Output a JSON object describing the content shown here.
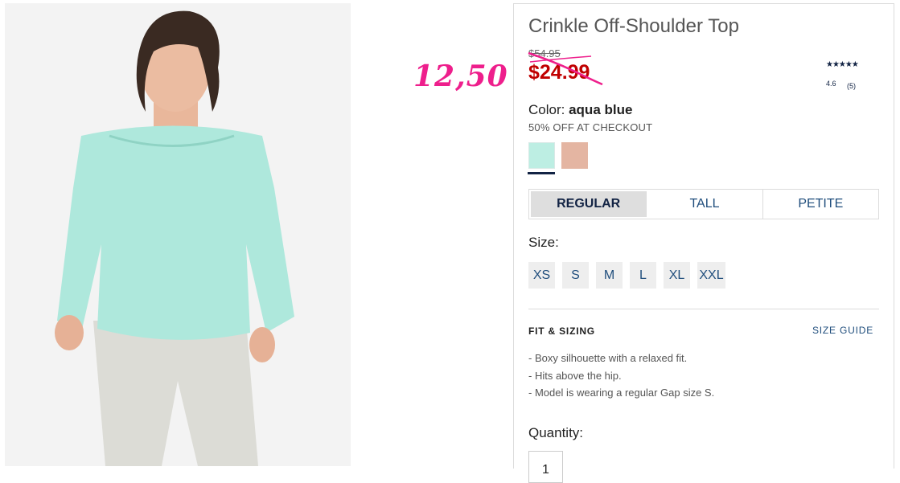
{
  "product": {
    "title": "Crinkle Off-Shoulder Top",
    "original_price": "$54.95",
    "sale_price": "$24.99",
    "annotation_price": "12,50",
    "rating": {
      "stars": "★★★★★",
      "value": "4.6",
      "count": "(5)"
    },
    "color_label": "Color:",
    "color_name": "aqua blue",
    "promo": "50% OFF AT CHECKOUT",
    "swatches": [
      {
        "name": "aqua blue",
        "color": "#bdeee3",
        "selected": true
      },
      {
        "name": "blush",
        "color": "#e4b5a2",
        "selected": false
      }
    ]
  },
  "fit_tabs": [
    {
      "label": "REGULAR",
      "active": true
    },
    {
      "label": "TALL",
      "active": false
    },
    {
      "label": "PETITE",
      "active": false
    }
  ],
  "size": {
    "label": "Size:",
    "options": [
      "XS",
      "S",
      "M",
      "L",
      "XL",
      "XXL"
    ]
  },
  "fit_sizing": {
    "heading": "FIT & SIZING",
    "guide_link": "SIZE GUIDE",
    "bullets": [
      "- Boxy silhouette with a relaxed fit.",
      "- Hits above the hip.",
      "- Model is wearing a regular Gap size S."
    ]
  },
  "quantity": {
    "label": "Quantity:",
    "value": "1"
  },
  "colors": {
    "accent_navy": "#122344",
    "link_blue": "#1f4d7c",
    "sale_red": "#c00000",
    "annotation_pink": "#ee1f8c"
  }
}
